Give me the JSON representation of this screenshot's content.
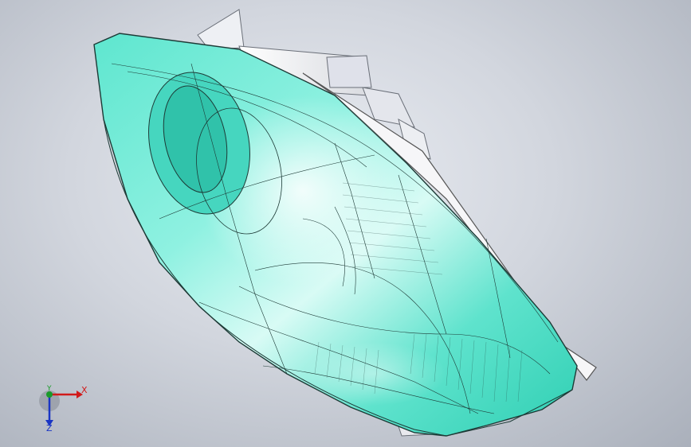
{
  "viewport": {
    "background_color": "#c9cdd6",
    "model": {
      "part": "headlamp-assembly",
      "lens_color": "#3fe0c4",
      "housing_color": "#f2f2f2",
      "bracket_color": "#e6e8ee"
    }
  },
  "triad": {
    "x_label": "X",
    "y_label": "Y",
    "z_label": "Z",
    "colors": {
      "x": "#d11a1a",
      "y": "#1a9a2a",
      "z": "#1a35c4"
    }
  }
}
